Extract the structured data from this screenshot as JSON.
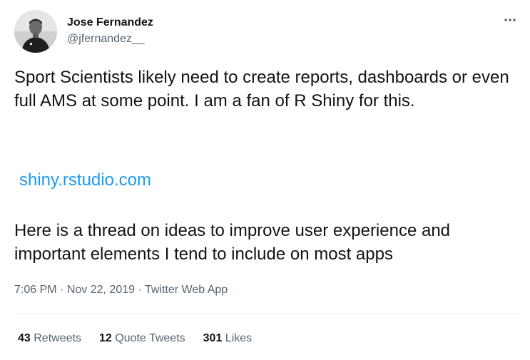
{
  "author": {
    "display_name": "Jose Fernandez",
    "handle": "@jfernandez__",
    "avatar_icon": "profile-photo"
  },
  "more_icon": "more-horizontal-icon",
  "tweet": {
    "paragraph_1": "Sport Scientists likely need to create reports, dashboards or even full AMS at some point. I am a fan of R Shiny for this.",
    "link_text": "shiny.rstudio.com",
    "paragraph_2": "Here is a thread on ideas to improve user experience and important elements I tend to include on most apps"
  },
  "meta": {
    "time": "7:06 PM",
    "separator": "·",
    "date": "Nov 22, 2019",
    "source": "Twitter Web App"
  },
  "stats": {
    "retweets_count": "43",
    "retweets_label": "Retweets",
    "quote_count": "12",
    "quote_label": "Quote Tweets",
    "likes_count": "301",
    "likes_label": "Likes"
  },
  "colors": {
    "link": "#1d9bf0",
    "secondary_text": "#536471",
    "primary_text": "#0f1419"
  }
}
